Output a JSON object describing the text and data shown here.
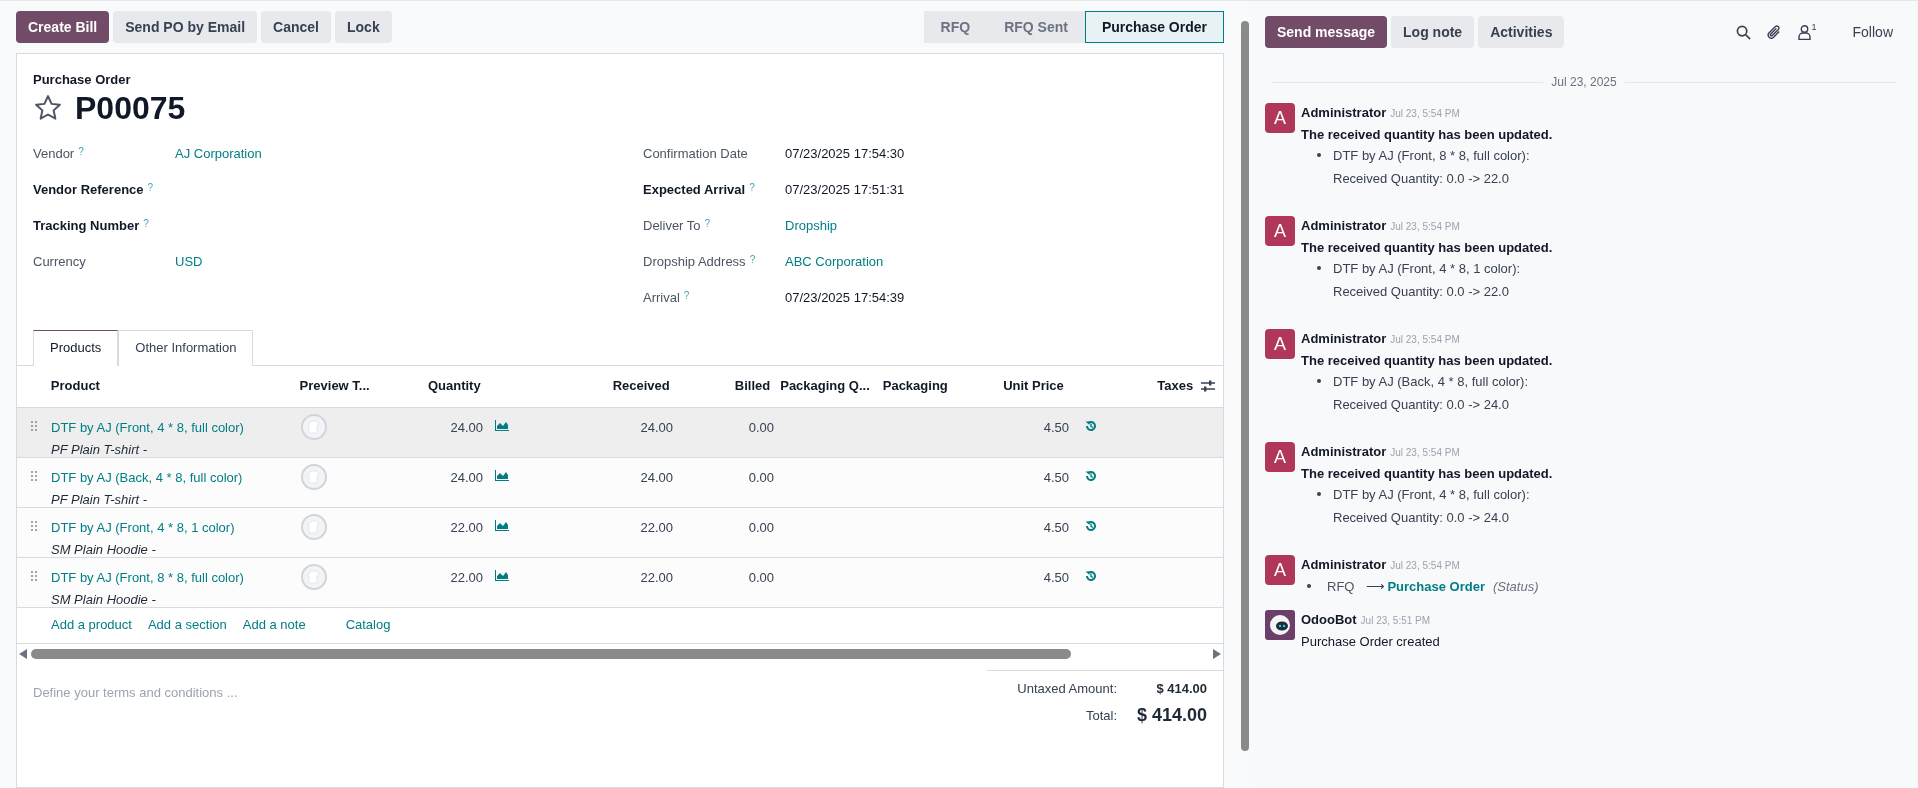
{
  "actions": [
    {
      "label": "Create Bill",
      "kind": "primary"
    },
    {
      "label": "Send PO by Email",
      "kind": "secondary"
    },
    {
      "label": "Cancel",
      "kind": "secondary"
    },
    {
      "label": "Lock",
      "kind": "secondary"
    }
  ],
  "stages": [
    {
      "label": "RFQ",
      "selected": false
    },
    {
      "label": "RFQ Sent",
      "selected": false
    },
    {
      "label": "Purchase Order",
      "selected": true
    }
  ],
  "form": {
    "subtitle": "Purchase Order",
    "name": "P00075",
    "starred": false,
    "left_fields": [
      {
        "label": "Vendor",
        "help": "?",
        "required": false,
        "value": "AJ Corporation",
        "kind": "link"
      },
      {
        "label": "Vendor Reference",
        "help": "?",
        "required": true
      },
      {
        "label": "Tracking Number",
        "help": "?",
        "required": true
      },
      {
        "label": "Currency",
        "required": false,
        "value": "USD",
        "kind": "link"
      }
    ],
    "right_fields": [
      {
        "label": "Confirmation Date",
        "required": false,
        "value": "07/23/2025 17:54:30",
        "kind": "text"
      },
      {
        "label": "Expected Arrival",
        "help": "?",
        "required": true,
        "value": "07/23/2025 17:51:31",
        "kind": "text"
      },
      {
        "label": "Deliver To",
        "help": "?",
        "required": false,
        "value": "Dropship",
        "kind": "link"
      },
      {
        "label": "Dropship Address",
        "help": "?",
        "required": false,
        "value": "ABC Corporation",
        "kind": "link"
      },
      {
        "label": "Arrival",
        "help": "?",
        "required": false,
        "value": "07/23/2025 17:54:39",
        "kind": "text"
      }
    ]
  },
  "tabs": [
    {
      "label": "Products",
      "selected": true
    },
    {
      "label": "Other Information",
      "selected": false
    }
  ],
  "table": {
    "columns": [
      "Product",
      "Preview T...",
      "Quantity",
      "Received",
      "Billed",
      "Packaging Q...",
      "Packaging",
      "Unit Price",
      "Taxes"
    ],
    "rows": [
      {
        "product": "DTF by AJ (Front, 4 * 8, full color)",
        "description": "PF Plain T-shirt -",
        "quantity": "24.00",
        "received": "24.00",
        "billed": "0.00",
        "unit_price": "4.50",
        "selected": true
      },
      {
        "product": "DTF by AJ (Back, 4 * 8, full color)",
        "description": "PF Plain T-shirt -",
        "quantity": "24.00",
        "received": "24.00",
        "billed": "0.00",
        "unit_price": "4.50",
        "selected": false
      },
      {
        "product": "DTF by AJ (Front, 4 * 8, 1 color)",
        "description": "SM Plain Hoodie -",
        "quantity": "22.00",
        "received": "22.00",
        "billed": "0.00",
        "unit_price": "4.50",
        "selected": false
      },
      {
        "product": "DTF by AJ (Front, 8 * 8, full color)",
        "description": "SM Plain Hoodie -",
        "quantity": "22.00",
        "received": "22.00",
        "billed": "0.00",
        "unit_price": "4.50",
        "selected": false
      }
    ],
    "add_links": [
      "Add a product",
      "Add a section",
      "Add a note",
      "Catalog"
    ]
  },
  "terms": {
    "placeholder": "Define your terms and conditions ..."
  },
  "totals": [
    {
      "label": "Untaxed Amount:",
      "value": "$ 414.00",
      "kind": "subtotal"
    },
    {
      "label": "Total:",
      "value": "$ 414.00",
      "kind": "total"
    }
  ],
  "chatter": {
    "buttons": [
      {
        "label": "Send message",
        "kind": "primary"
      },
      {
        "label": "Log note",
        "kind": "secondary"
      },
      {
        "label": "Activities",
        "kind": "secondary"
      }
    ],
    "follower_count": "1",
    "follow": "Follow",
    "date": "Jul 23, 2025",
    "messages": [
      {
        "kind": "update",
        "author": "Administrator",
        "avatar_letter": "A",
        "time": "Jul 23, 5:54 PM",
        "title": "The received quantity has been updated.",
        "item": "DTF by AJ (Front, 8 * 8, full color):",
        "detail": "Received Quantity: 0.0 -> 22.0"
      },
      {
        "kind": "update",
        "author": "Administrator",
        "avatar_letter": "A",
        "time": "Jul 23, 5:54 PM",
        "title": "The received quantity has been updated.",
        "item": "DTF by AJ (Front, 4 * 8, 1 color):",
        "detail": "Received Quantity: 0.0 -> 22.0"
      },
      {
        "kind": "update",
        "author": "Administrator",
        "avatar_letter": "A",
        "time": "Jul 23, 5:54 PM",
        "title": "The received quantity has been updated.",
        "item": "DTF by AJ (Back, 4 * 8, full color):",
        "detail": "Received Quantity: 0.0 -> 24.0"
      },
      {
        "kind": "update",
        "author": "Administrator",
        "avatar_letter": "A",
        "time": "Jul 23, 5:54 PM",
        "title": "The received quantity has been updated.",
        "item": "DTF by AJ (Front, 4 * 8, full color):",
        "detail": "Received Quantity: 0.0 -> 24.0"
      },
      {
        "kind": "tracking",
        "author": "Administrator",
        "avatar_letter": "A",
        "time": "Jul 23, 5:54 PM",
        "old": "RFQ",
        "arrow": "⟶",
        "new": "Purchase Order",
        "field": "(Status)"
      },
      {
        "kind": "note",
        "author": "OdooBot",
        "time": "Jul 23, 5:51 PM",
        "body": "Purchase Order created"
      }
    ]
  }
}
